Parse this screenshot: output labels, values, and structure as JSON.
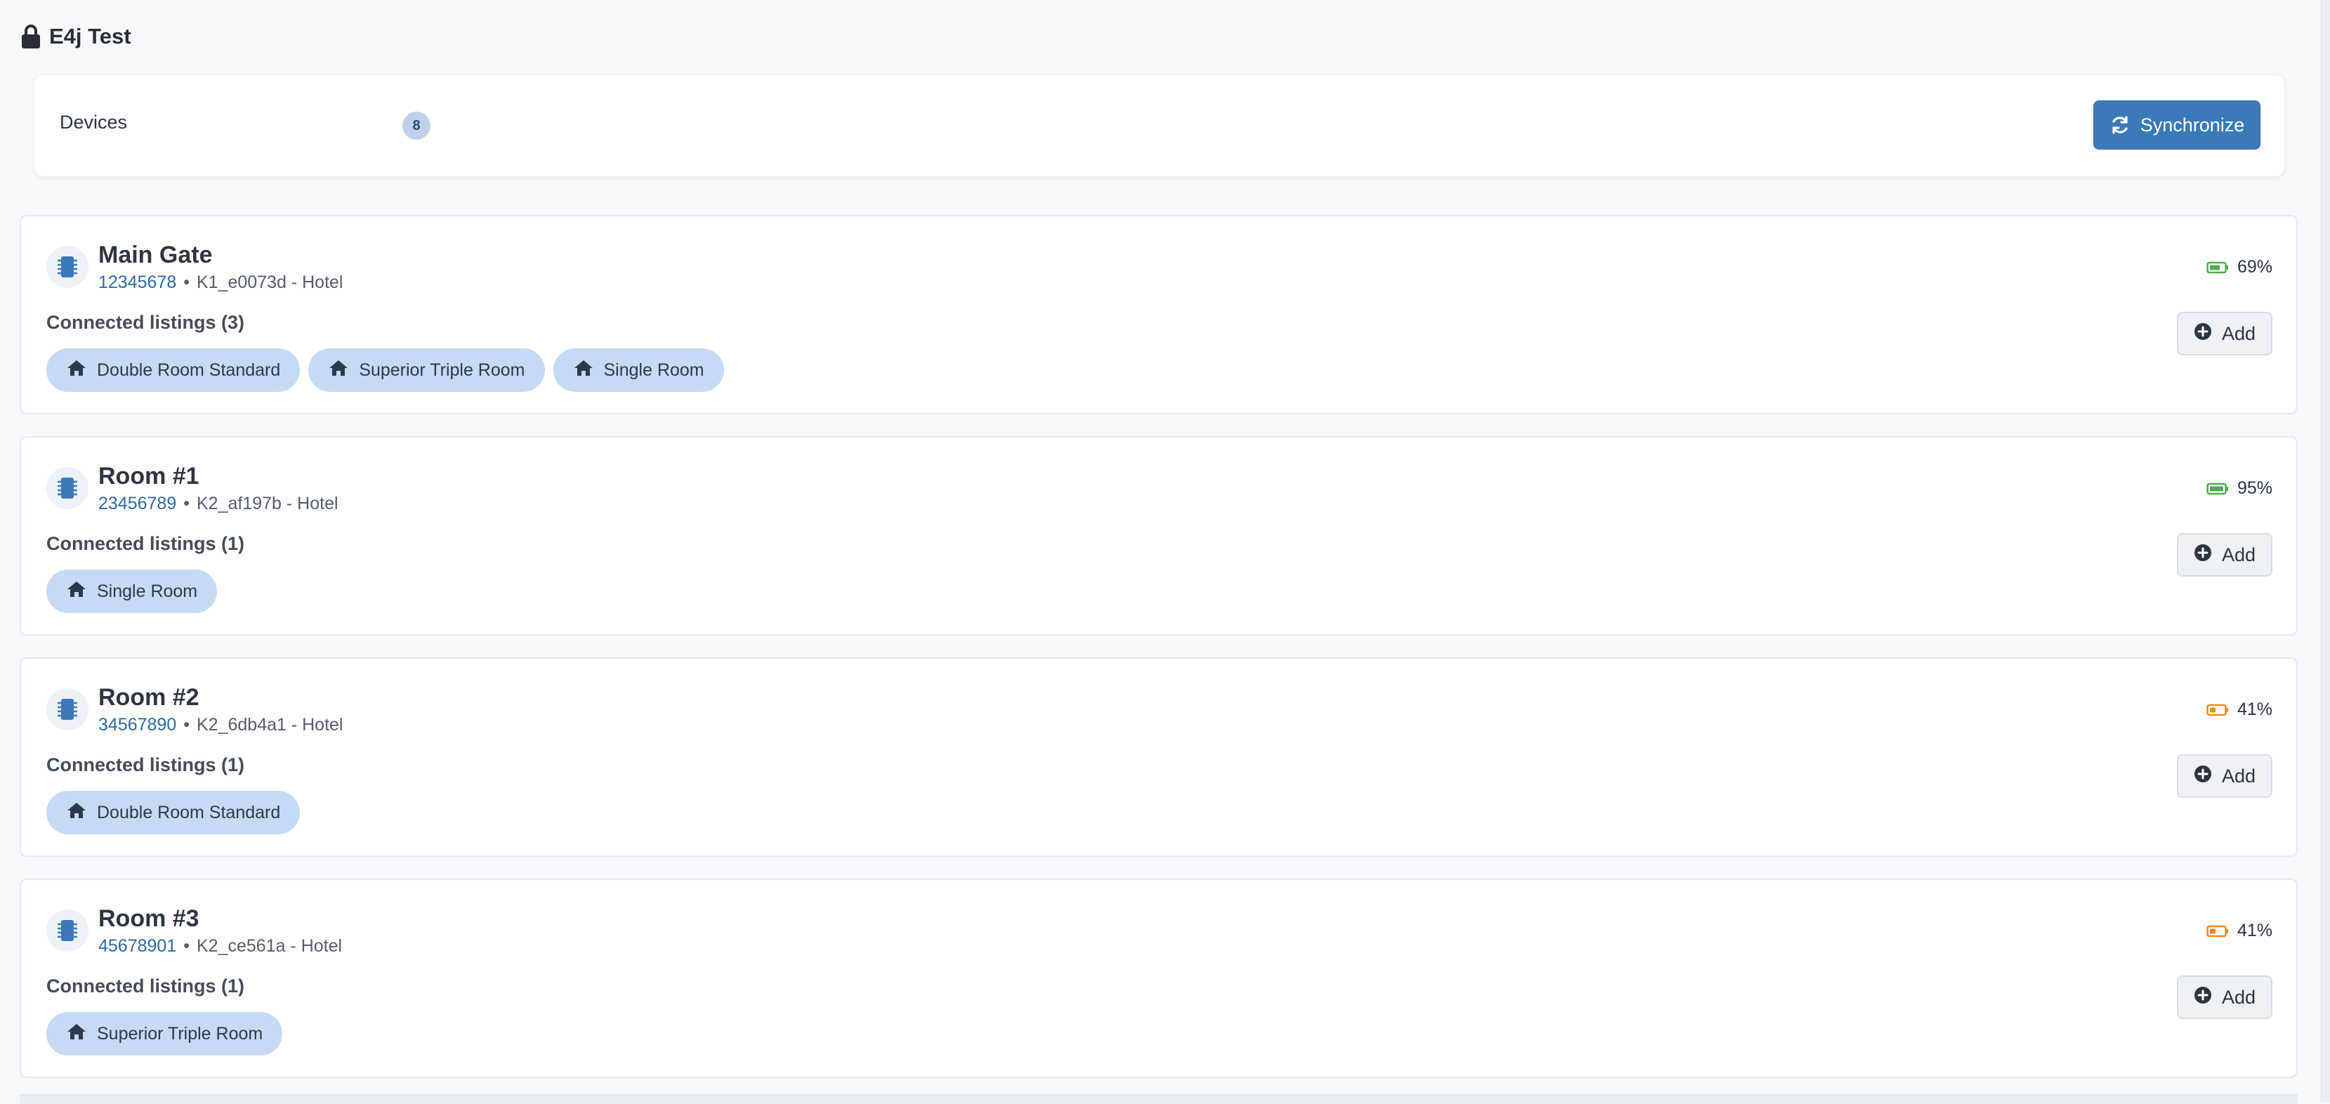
{
  "header": {
    "title": "E4j Test",
    "icon": "lock-icon"
  },
  "devices_bar": {
    "label": "Devices",
    "count": "8",
    "sync_label": "Synchronize"
  },
  "colors": {
    "accent": "#3a7ab8",
    "battery_good": "#4caf50",
    "battery_mid": "#f08a24",
    "pill_bg": "#c6daf3"
  },
  "devices": [
    {
      "name": "Main Gate",
      "serial": "12345678",
      "code": "K1_e0073d - Hotel",
      "battery": "69%",
      "battery_level": 0.69,
      "battery_color": "#4caf50",
      "listings_label": "Connected listings (3)",
      "listings": [
        "Double Room Standard",
        "Superior Triple Room",
        "Single Room"
      ],
      "add_label": "Add"
    },
    {
      "name": "Room #1",
      "serial": "23456789",
      "code": "K2_af197b - Hotel",
      "battery": "95%",
      "battery_level": 0.95,
      "battery_color": "#4caf50",
      "listings_label": "Connected listings (1)",
      "listings": [
        "Single Room"
      ],
      "add_label": "Add"
    },
    {
      "name": "Room #2",
      "serial": "34567890",
      "code": "K2_6db4a1 - Hotel",
      "battery": "41%",
      "battery_level": 0.41,
      "battery_color": "#f08a24",
      "listings_label": "Connected listings (1)",
      "listings": [
        "Double Room Standard"
      ],
      "add_label": "Add"
    },
    {
      "name": "Room #3",
      "serial": "45678901",
      "code": "K2_ce561a - Hotel",
      "battery": "41%",
      "battery_level": 0.41,
      "battery_color": "#f08a24",
      "listings_label": "Connected listings (1)",
      "listings": [
        "Superior Triple Room"
      ],
      "add_label": "Add"
    }
  ]
}
